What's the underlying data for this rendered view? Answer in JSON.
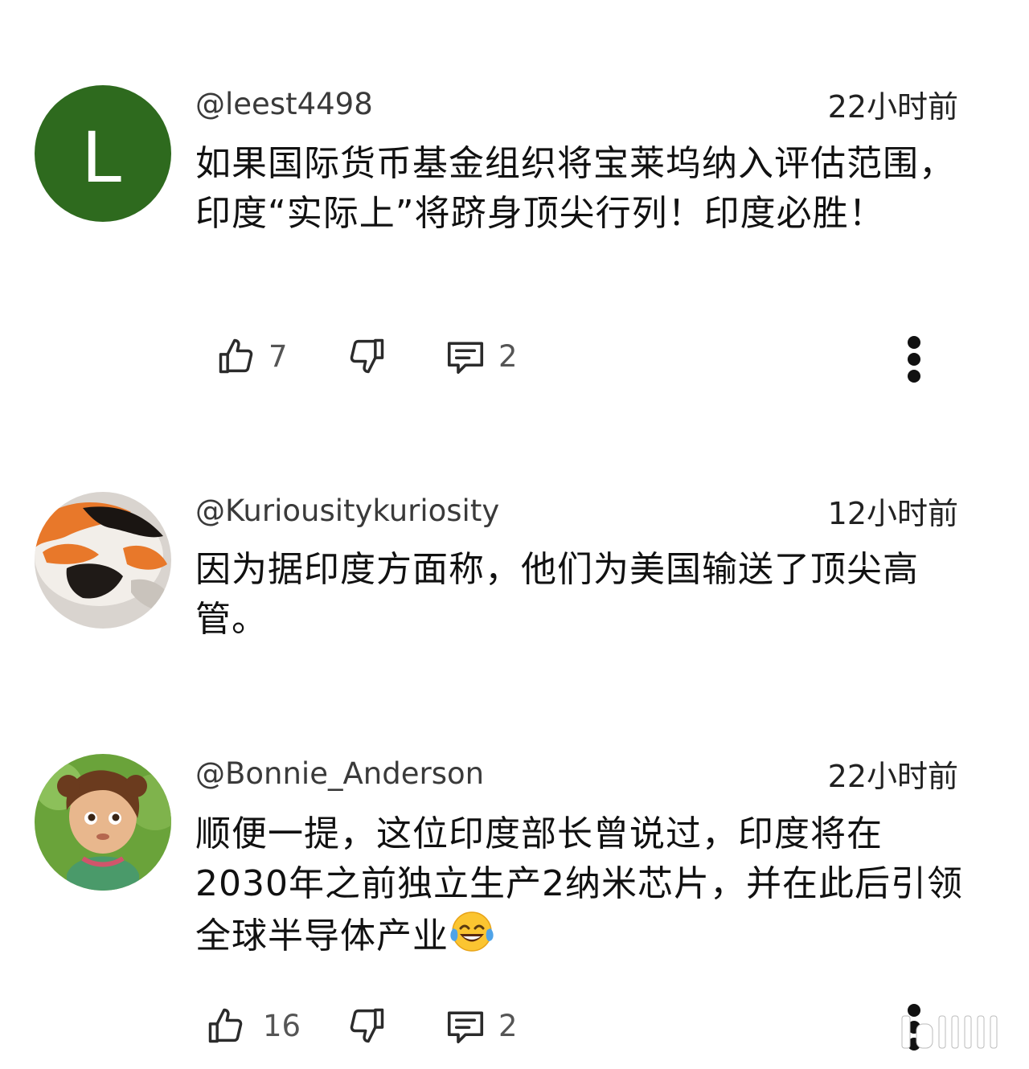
{
  "comments": [
    {
      "avatar": {
        "type": "letter",
        "letter": "L",
        "color": "#2e6a1e"
      },
      "username": "@leest4498",
      "time": "22小时前",
      "text": "如果国际货币基金组织将宝莱坞纳入评估范围，印度“实际上”将跻身顶尖行列！印度必胜！",
      "likes": "7",
      "replies": "2"
    },
    {
      "avatar": {
        "type": "image",
        "desc": "orange-black-white-plush"
      },
      "username": "@Kuriousitykuriosity",
      "time": "12小时前",
      "text": "因为据印度方面称，他们为美国输送了顶尖高管。"
    },
    {
      "avatar": {
        "type": "image",
        "desc": "cartoon-girl"
      },
      "username": "@Bonnie_Anderson",
      "time": "22小时前",
      "text": "顺便一提，这位印度部长曾说过，印度将在2030年之前独立生产2纳米芯片，并在此后引领全球半导体产业",
      "emoji": "laughing-tears-emoji",
      "likes": "16",
      "replies": "2"
    }
  ],
  "icons": {
    "like": "thumbs-up-icon",
    "dislike": "thumbs-down-icon",
    "reply": "comment-icon",
    "more": "more-vert-icon"
  }
}
